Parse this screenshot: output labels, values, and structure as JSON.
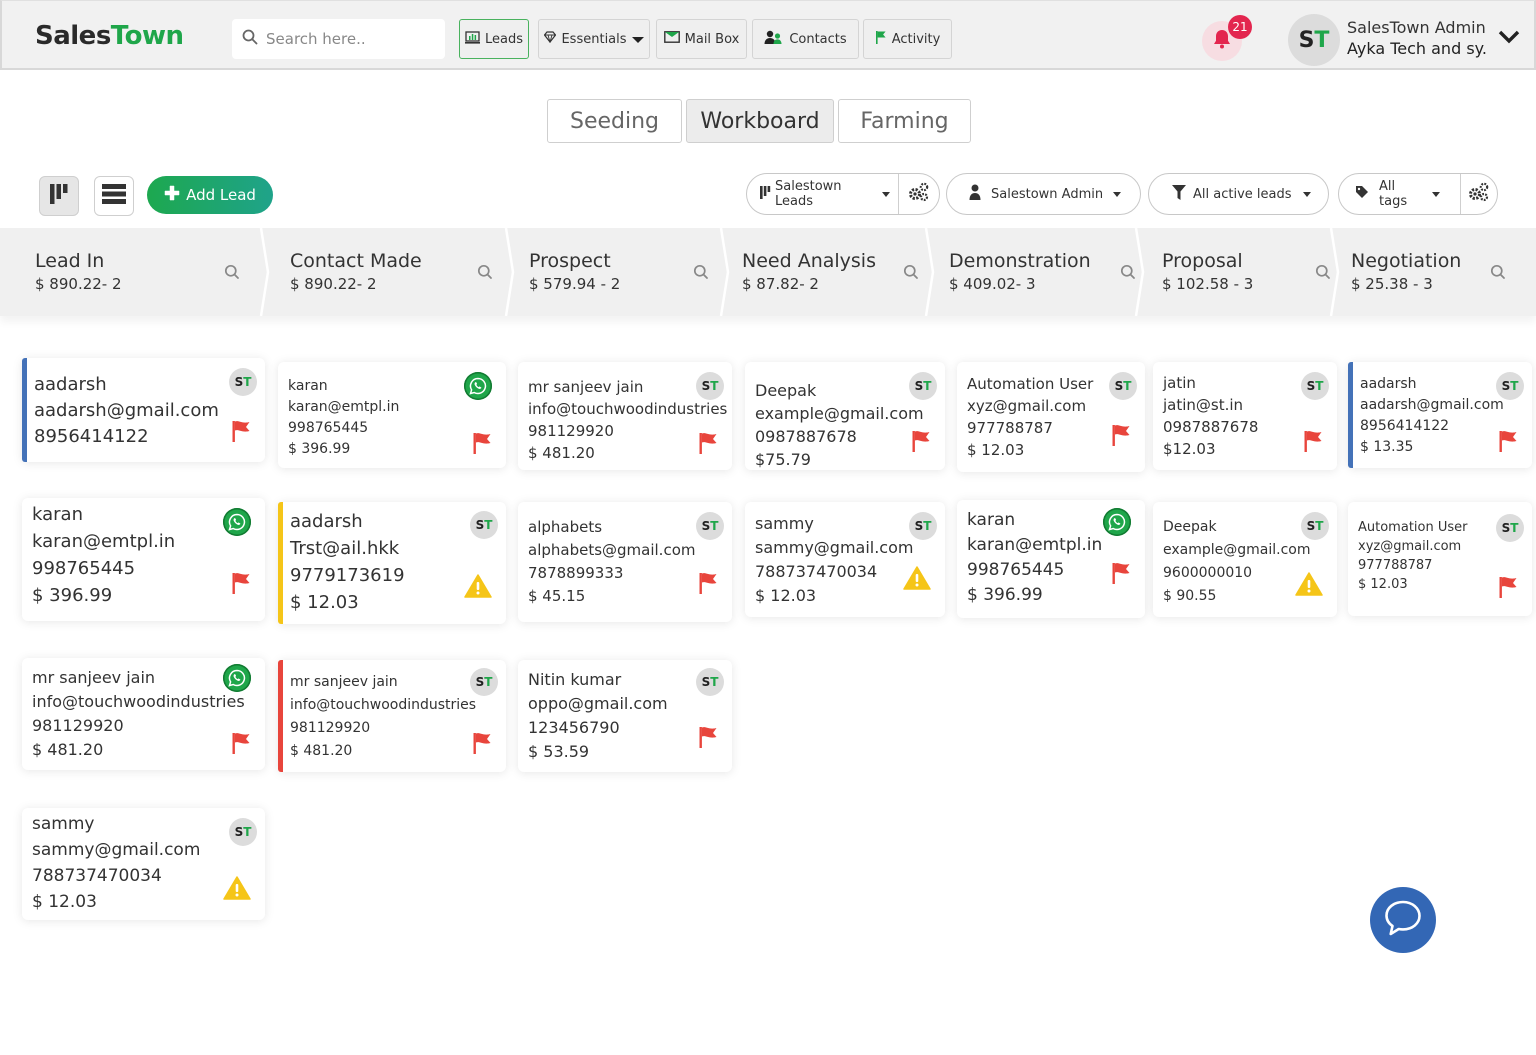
{
  "navbar": {
    "logo_part1": "Sales",
    "logo_part2": "Town",
    "search_placeholder": "Search here..",
    "menu": [
      {
        "label": "Leads",
        "icon": "chart-monitor-icon",
        "active": true
      },
      {
        "label": "Essentials",
        "icon": "diamond-icon",
        "dropdown": true
      },
      {
        "label": "Mail Box",
        "icon": "mail-icon"
      },
      {
        "label": "Contacts",
        "icon": "users-icon"
      },
      {
        "label": "Activity",
        "icon": "flag-icon"
      }
    ],
    "notifications_count": "21",
    "user_initials_1": "S",
    "user_initials_2": "T",
    "user_name": "SalesTown Admin",
    "user_org": "Ayka Tech and sy."
  },
  "modes": [
    {
      "label": "Seeding",
      "active": false
    },
    {
      "label": "Workboard",
      "active": true
    },
    {
      "label": "Farming",
      "active": false
    }
  ],
  "toolbar": {
    "add_lead_label": "Add Lead",
    "pipeline_filter": "Salestown Leads",
    "owner_filter": "Salestown Admin",
    "status_filter": "All active leads",
    "tags_filter": "All tags"
  },
  "stages": [
    {
      "name": "Lead In",
      "summary": "$ 890.22- 2"
    },
    {
      "name": "Contact Made",
      "summary": "$ 890.22- 2"
    },
    {
      "name": "Prospect",
      "summary": "$ 579.94 - 2"
    },
    {
      "name": "Need Analysis",
      "summary": "$ 87.82- 2"
    },
    {
      "name": "Demonstration",
      "summary": "$ 409.02- 3"
    },
    {
      "name": "Proposal",
      "summary": "$ 102.58 - 3"
    },
    {
      "name": "Negotiation",
      "summary": "$ 25.38 - 3"
    }
  ],
  "cards": [
    {
      "name": "aadarsh",
      "email": "aadarsh@gmail.com",
      "phone": "8956414122",
      "amount": "",
      "badge": "st",
      "status": "flag",
      "accent": "#4472b8"
    },
    {
      "name": "karan",
      "email": "karan@emtpl.in",
      "phone": "998765445",
      "amount": "$ 396.99",
      "badge": "whatsapp",
      "status": "flag",
      "accent": ""
    },
    {
      "name": "mr sanjeev jain",
      "email": "info@touchwoodindustries",
      "phone": "981129920",
      "amount": "$ 481.20",
      "badge": "st",
      "status": "flag",
      "accent": ""
    },
    {
      "name": "Deepak",
      "email": "example@gmail.com",
      "phone": "0987887678",
      "amount": "$75.79",
      "badge": "st",
      "status": "flag",
      "accent": ""
    },
    {
      "name": "Automation User",
      "email": "xyz@gmail.com",
      "phone": "977788787",
      "amount": "$ 12.03",
      "badge": "st",
      "status": "flag",
      "accent": ""
    },
    {
      "name": "jatin",
      "email": "jatin@st.in",
      "phone": "0987887678",
      "amount": "$12.03",
      "badge": "st",
      "status": "flag",
      "accent": ""
    },
    {
      "name": "aadarsh",
      "email": "aadarsh@gmail.com",
      "phone": "8956414122",
      "amount": "$ 13.35",
      "badge": "st",
      "status": "flag",
      "accent": "#4472b8"
    },
    {
      "name": "karan",
      "email": "karan@emtpl.in",
      "phone": "998765445",
      "amount": "$ 396.99",
      "badge": "whatsapp",
      "status": "flag",
      "accent": ""
    },
    {
      "name": "aadarsh",
      "email": "Trst@ail.hkk",
      "phone": "9779173619",
      "amount": "$ 12.03",
      "badge": "st",
      "status": "warning",
      "accent": "#f5c518"
    },
    {
      "name": "alphabets",
      "email": "alphabets@gmail.com",
      "phone": "7878899333",
      "amount": "$ 45.15",
      "badge": "st",
      "status": "flag",
      "accent": ""
    },
    {
      "name": "sammy",
      "email": "sammy@gmail.com",
      "phone": "788737470034",
      "amount": "$ 12.03",
      "badge": "st",
      "status": "warning",
      "accent": ""
    },
    {
      "name": "karan",
      "email": "karan@emtpl.in",
      "phone": "998765445",
      "amount": "$ 396.99",
      "badge": "whatsapp",
      "status": "flag",
      "accent": ""
    },
    {
      "name": "Deepak",
      "email": "example@gmail.com",
      "phone": "9600000010",
      "amount": "$ 90.55",
      "badge": "st",
      "status": "warning",
      "accent": ""
    },
    {
      "name": "Automation User",
      "email": "xyz@gmail.com",
      "phone": "977788787",
      "amount": "$ 12.03",
      "badge": "st",
      "status": "flag",
      "accent": ""
    },
    {
      "name": "mr sanjeev jain",
      "email": "info@touchwoodindustries",
      "phone": "981129920",
      "amount": "$ 481.20",
      "badge": "whatsapp",
      "status": "flag",
      "accent": ""
    },
    {
      "name": "mr sanjeev jain",
      "email": "info@touchwoodindustries",
      "phone": "981129920",
      "amount": "$ 481.20",
      "badge": "st",
      "status": "flag",
      "accent": "#e8453c"
    },
    {
      "name": "Nitin kumar",
      "email": "oppo@gmail.com",
      "phone": "123456790",
      "amount": "$ 53.59",
      "badge": "st",
      "status": "flag",
      "accent": ""
    },
    {
      "name": "sammy",
      "email": "sammy@gmail.com",
      "phone": "788737470034",
      "amount": "$ 12.03",
      "badge": "st",
      "status": "warning",
      "accent": ""
    }
  ],
  "colors": {
    "brand_green": "#1fa64a",
    "flag_red": "#e8453c",
    "warning_yellow": "#f5c518",
    "accent_blue": "#4472b8",
    "chat_blue": "#3367b5",
    "notification_red": "#e3264f"
  }
}
